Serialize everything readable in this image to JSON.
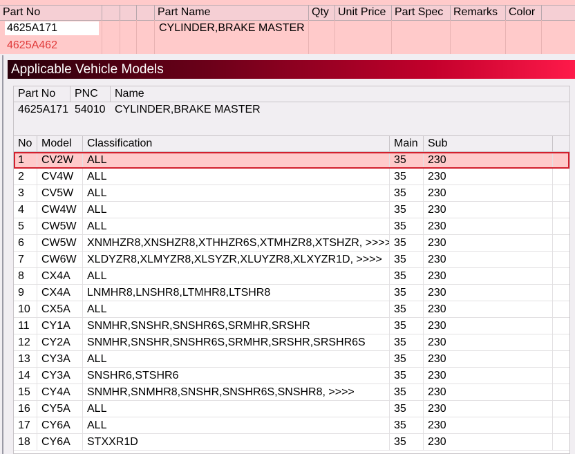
{
  "parts_grid": {
    "columns": [
      "Part No",
      "",
      "",
      "",
      "Part Name",
      "Qty",
      "Unit Price",
      "Part Spec",
      "Remarks",
      "Color"
    ],
    "selected_part_no": "4625A171",
    "alt_part_no": "4625A462",
    "part_name": "CYLINDER,BRAKE MASTER",
    "colors": {
      "row_bg": "#ffcaca",
      "alt_text": "#e03a3a"
    }
  },
  "dialog": {
    "title": "Applicable Vehicle Models",
    "info": {
      "headers": [
        "Part No",
        "PNC",
        "Name"
      ],
      "values": [
        "4625A171",
        "54010",
        "CYLINDER,BRAKE MASTER"
      ]
    },
    "table": {
      "headers": [
        "No",
        "Model",
        "Classification",
        "Main",
        "Sub"
      ],
      "rows": [
        {
          "no": "1",
          "model": "CV2W",
          "classification": "ALL",
          "main": "35",
          "sub": "230",
          "selected": true
        },
        {
          "no": "2",
          "model": "CV4W",
          "classification": "ALL",
          "main": "35",
          "sub": "230"
        },
        {
          "no": "3",
          "model": "CV5W",
          "classification": "ALL",
          "main": "35",
          "sub": "230"
        },
        {
          "no": "4",
          "model": "CW4W",
          "classification": "ALL",
          "main": "35",
          "sub": "230"
        },
        {
          "no": "5",
          "model": "CW5W",
          "classification": "ALL",
          "main": "35",
          "sub": "230"
        },
        {
          "no": "6",
          "model": "CW5W",
          "classification": "XNMHZR8,XNSHZR8,XTHHZR6S,XTMHZR8,XTSHZR,  >>>>",
          "main": "35",
          "sub": "230"
        },
        {
          "no": "7",
          "model": "CW6W",
          "classification": "XLDYZR8,XLMYZR8,XLSYZR,XLUYZR8,XLXYZR1D,  >>>>",
          "main": "35",
          "sub": "230"
        },
        {
          "no": "8",
          "model": "CX4A",
          "classification": "ALL",
          "main": "35",
          "sub": "230"
        },
        {
          "no": "9",
          "model": "CX4A",
          "classification": "LNMHR8,LNSHR8,LTMHR8,LTSHR8",
          "main": "35",
          "sub": "230"
        },
        {
          "no": "10",
          "model": "CX5A",
          "classification": "ALL",
          "main": "35",
          "sub": "230"
        },
        {
          "no": "11",
          "model": "CY1A",
          "classification": "SNMHR,SNSHR,SNSHR6S,SRMHR,SRSHR",
          "main": "35",
          "sub": "230"
        },
        {
          "no": "12",
          "model": "CY2A",
          "classification": "SNMHR,SNSHR,SNSHR6S,SRMHR,SRSHR,SRSHR6S",
          "main": "35",
          "sub": "230"
        },
        {
          "no": "13",
          "model": "CY3A",
          "classification": "ALL",
          "main": "35",
          "sub": "230"
        },
        {
          "no": "14",
          "model": "CY3A",
          "classification": "SNSHR6,STSHR6",
          "main": "35",
          "sub": "230"
        },
        {
          "no": "15",
          "model": "CY4A",
          "classification": "SNMHR,SNMHR8,SNSHR,SNSHR6S,SNSHR8,  >>>>",
          "main": "35",
          "sub": "230"
        },
        {
          "no": "16",
          "model": "CY5A",
          "classification": "ALL",
          "main": "35",
          "sub": "230"
        },
        {
          "no": "17",
          "model": "CY6A",
          "classification": "ALL",
          "main": "35",
          "sub": "230"
        },
        {
          "no": "18",
          "model": "CY6A",
          "classification": "STXXR1D",
          "main": "35",
          "sub": "230"
        }
      ],
      "colors": {
        "selected_bg": "#ffcaca",
        "selected_border": "#d21f2d"
      }
    }
  }
}
